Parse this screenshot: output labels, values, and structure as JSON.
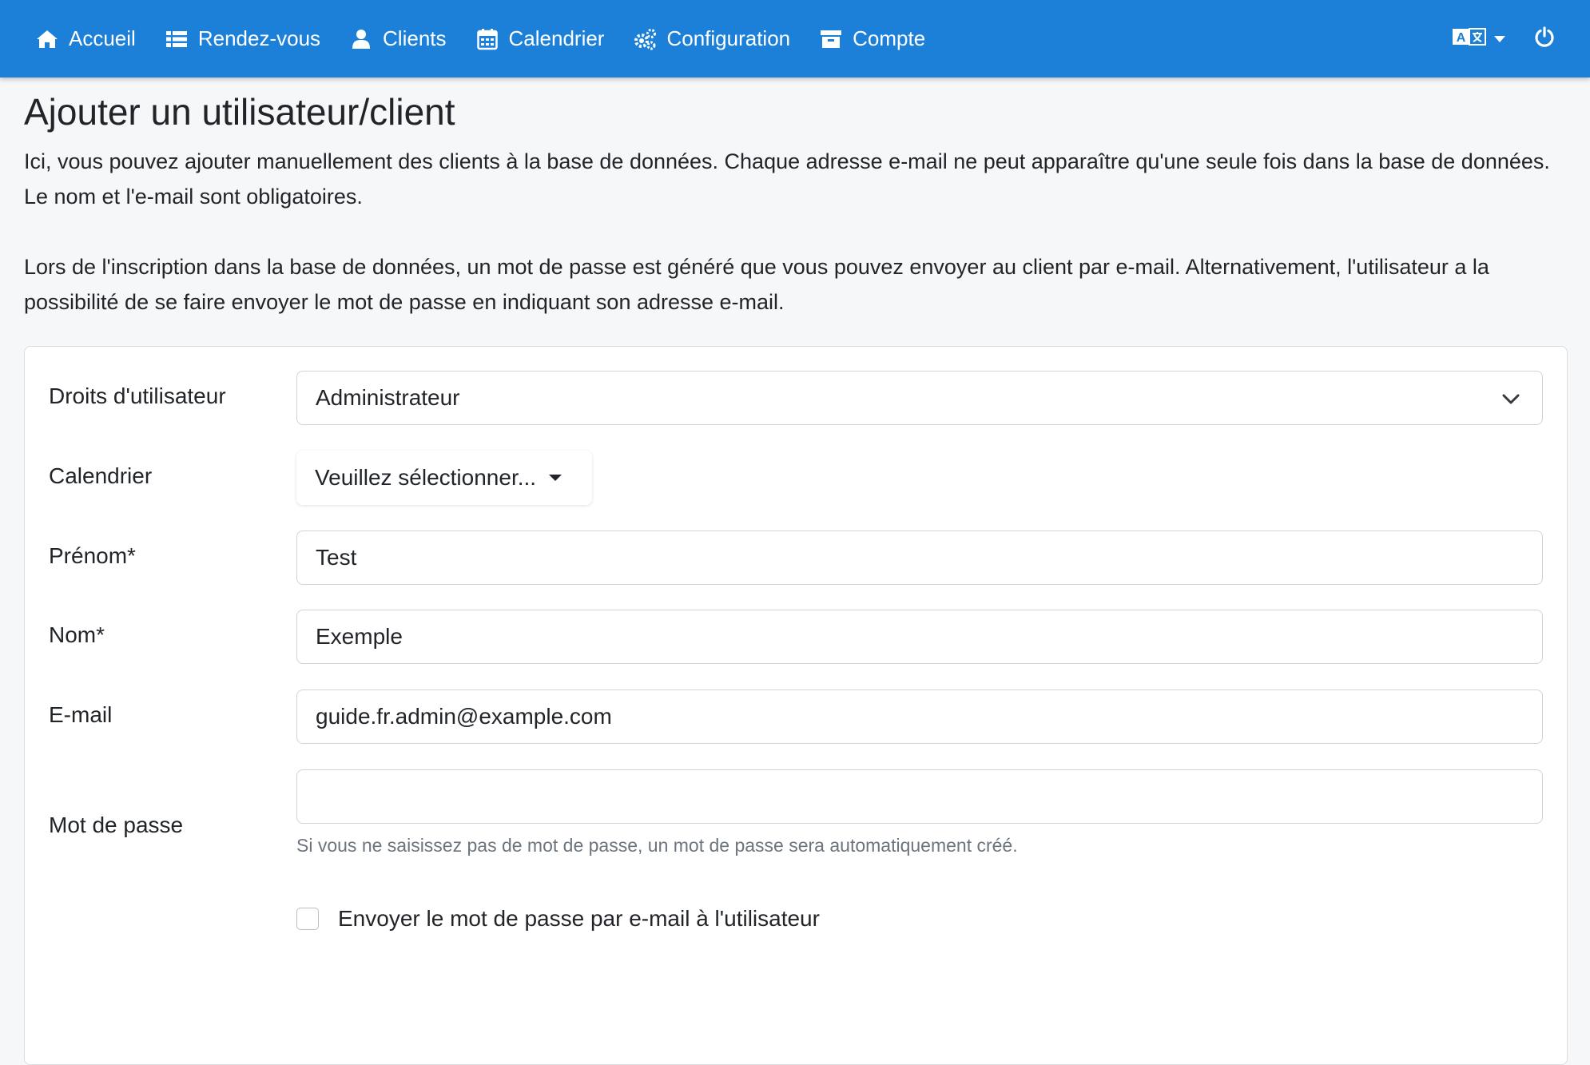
{
  "navbar": {
    "items": [
      {
        "label": "Accueil",
        "icon": "home-icon"
      },
      {
        "label": "Rendez-vous",
        "icon": "list-icon"
      },
      {
        "label": "Clients",
        "icon": "user-icon"
      },
      {
        "label": "Calendrier",
        "icon": "calendar-icon"
      },
      {
        "label": "Configuration",
        "icon": "cogs-icon"
      },
      {
        "label": "Compte",
        "icon": "archive-icon"
      }
    ],
    "language_icon": "language-icon",
    "power_icon": "power-icon",
    "background_color": "#1c80d9"
  },
  "page": {
    "title": "Ajouter un utilisateur/client",
    "intro_1": "Ici, vous pouvez ajouter manuellement des clients à la base de données. Chaque adresse e-mail ne peut apparaître qu'une seule fois dans la base de données. Le nom et l'e-mail sont obligatoires.",
    "intro_2": "Lors de l'inscription dans la base de données, un mot de passe est généré que vous pouvez envoyer au client par e-mail. Alternativement, l'utilisateur a la possibilité de se faire envoyer le mot de passe en indiquant son adresse e-mail."
  },
  "form": {
    "rights": {
      "label": "Droits d'utilisateur",
      "value": "Administrateur"
    },
    "calendar": {
      "label": "Calendrier",
      "value": "Veuillez sélectionner..."
    },
    "firstname": {
      "label": "Prénom*",
      "value": "Test"
    },
    "lastname": {
      "label": "Nom*",
      "value": "Exemple"
    },
    "email": {
      "label": "E-mail",
      "value": "guide.fr.admin@example.com"
    },
    "password": {
      "label": "Mot de passe",
      "value": "",
      "help": "Si vous ne saisissez pas de mot de passe, un mot de passe sera automatiquement créé."
    },
    "send_password": {
      "label": "Envoyer le mot de passe par e-mail à l'utilisateur",
      "checked": false
    }
  }
}
